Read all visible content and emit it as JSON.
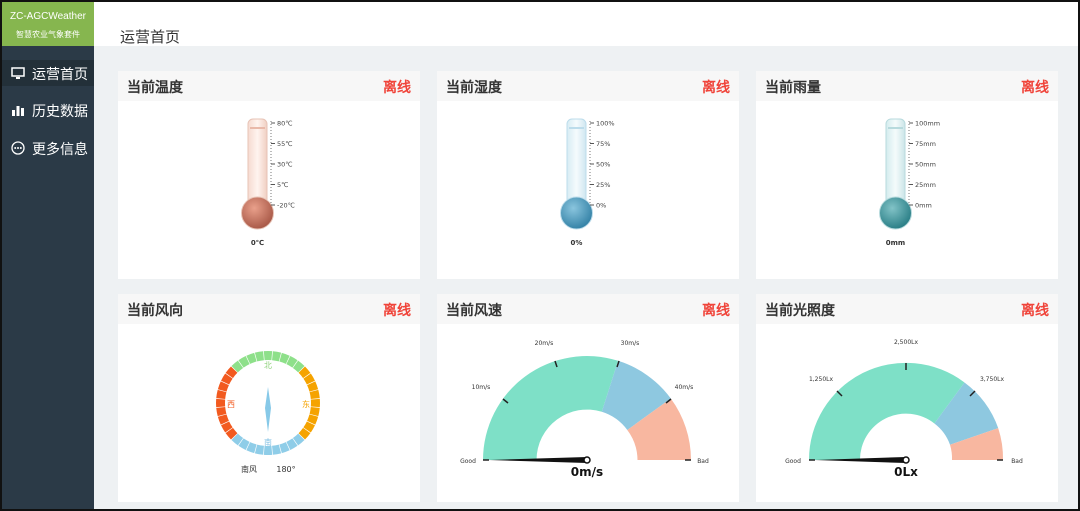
{
  "brand": {
    "title": "ZC-AGCWeather",
    "subtitle": "智慧农业气象套件"
  },
  "nav": [
    {
      "label": "运营首页",
      "icon": "monitor-icon"
    },
    {
      "label": "历史数据",
      "icon": "bar-chart-icon"
    },
    {
      "label": "更多信息",
      "icon": "more-icon"
    }
  ],
  "page_tab": "运营首页",
  "status_color": "#f0443a",
  "cards": {
    "temperature": {
      "title": "当前温度",
      "status": "离线",
      "ticks": [
        "80℃",
        "55℃",
        "30℃",
        "5℃",
        "-20℃"
      ],
      "value_label": "0℃",
      "level": 0
    },
    "humidity": {
      "title": "当前湿度",
      "status": "离线",
      "ticks": [
        "100%",
        "75%",
        "50%",
        "25%",
        "0%"
      ],
      "value_label": "0%",
      "level": 0
    },
    "rain": {
      "title": "当前雨量",
      "status": "离线",
      "ticks": [
        "100mm",
        "75mm",
        "50mm",
        "25mm",
        "0mm"
      ],
      "value_label": "0mm",
      "level": 0
    },
    "wind_dir": {
      "title": "当前风向",
      "status": "离线",
      "dir_n": "北",
      "dir_s": "南",
      "dir_e": "东",
      "dir_w": "西",
      "reading_name": "南风",
      "reading_deg": "180°"
    },
    "wind_speed": {
      "title": "当前风速",
      "status": "离线",
      "ticks": [
        "10m/s",
        "20m/s",
        "30m/s",
        "40m/s"
      ],
      "good": "Good",
      "bad": "Bad",
      "value_label": "0m/s",
      "value": 0
    },
    "light": {
      "title": "当前光照度",
      "status": "离线",
      "ticks": [
        "1,250Lx",
        "2,500Lx",
        "3,750Lx"
      ],
      "good": "Good",
      "bad": "Bad",
      "value_label": "0Lx",
      "value": 0
    }
  }
}
